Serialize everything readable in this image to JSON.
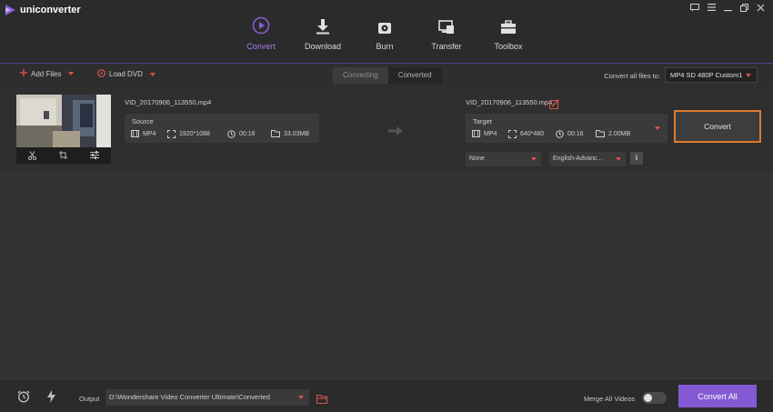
{
  "app": {
    "name": "uniconverter"
  },
  "nav": {
    "items": [
      {
        "label": "Convert",
        "icon": "convert-icon",
        "active": true
      },
      {
        "label": "Download",
        "icon": "download-icon",
        "active": false
      },
      {
        "label": "Burn",
        "icon": "burn-icon",
        "active": false
      },
      {
        "label": "Transfer",
        "icon": "transfer-icon",
        "active": false
      },
      {
        "label": "Toolbox",
        "icon": "toolbox-icon",
        "active": false
      }
    ]
  },
  "toolbar": {
    "add_files": "Add Files",
    "load_dvd": "Load DVD",
    "tabs": [
      "Converting",
      "Converted"
    ],
    "convert_all_to_label": "Convert all files to:",
    "format_value": "MP4 SD 480P Custom1"
  },
  "file": {
    "source_name": "VID_20170906_113550.mp4",
    "target_name": "VID_20170906_113550.mp4",
    "source": {
      "label": "Source",
      "format": "MP4",
      "resolution": "1920*1088",
      "duration": "00:16",
      "size": "33.03MB"
    },
    "target": {
      "label": "Target",
      "format": "MP4",
      "resolution": "640*480",
      "duration": "00:16",
      "size": "2.00MB"
    },
    "subtitle_value": "None",
    "audio_value": "English-Advanc...",
    "info_label": "i",
    "convert_label": "Convert"
  },
  "bottom": {
    "output_label": "Output",
    "output_path": "D:\\Wondershare Video Converter Ultimate\\Converted",
    "merge_label": "Merge All Videos",
    "convert_all_label": "Convert All"
  },
  "colors": {
    "accent": "#8459d4",
    "highlight": "#e07a2e",
    "caret": "#d9534f"
  }
}
